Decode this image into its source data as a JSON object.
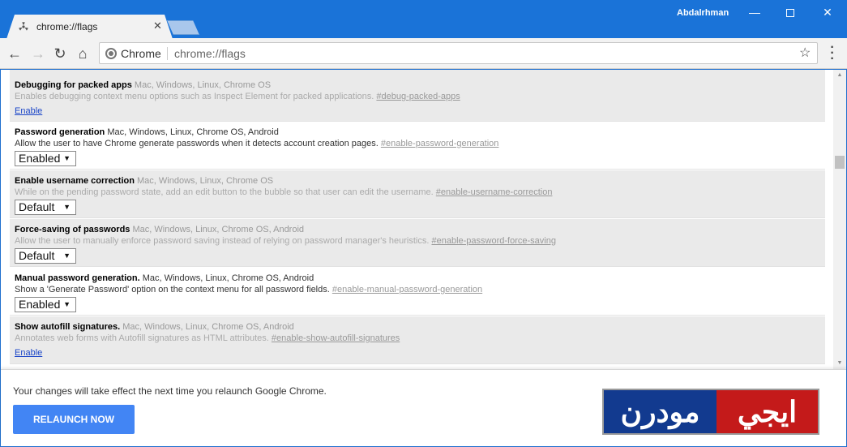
{
  "window": {
    "user_name": "Abdalrhman",
    "minimize": "—",
    "close": "✕"
  },
  "tab": {
    "title": "chrome://flags",
    "close": "✕"
  },
  "toolbar": {
    "back": "←",
    "forward": "→",
    "reload": "↻",
    "home": "⌂",
    "omnibox_label": "Chrome",
    "url": "chrome://flags",
    "star": "☆",
    "menu": "⋮"
  },
  "flags": [
    {
      "name": "Debugging for packed apps",
      "platforms": " Mac, Windows, Linux, Chrome OS",
      "description": "Enables debugging context menu options such as Inspect Element for packed applications. ",
      "hash": "#debug-packed-apps",
      "control": "link",
      "value": "Enable",
      "unsupported": true
    },
    {
      "name": "Password generation",
      "platforms": " Mac, Windows, Linux, Chrome OS, Android",
      "description": "Allow the user to have Chrome generate passwords when it detects account creation pages. ",
      "hash": "#enable-password-generation",
      "control": "select",
      "value": "Enabled",
      "unsupported": false
    },
    {
      "name": "Enable username correction",
      "platforms": " Mac, Windows, Linux, Chrome OS",
      "description": "While on the pending password state, add an edit button to the bubble so that user can edit the username. ",
      "hash": "#enable-username-correction",
      "control": "select",
      "value": "Default",
      "unsupported": true
    },
    {
      "name": "Force-saving of passwords",
      "platforms": " Mac, Windows, Linux, Chrome OS, Android",
      "description": "Allow the user to manually enforce password saving instead of relying on password manager's heuristics. ",
      "hash": "#enable-password-force-saving",
      "control": "select",
      "value": "Default",
      "unsupported": true
    },
    {
      "name": "Manual password generation.",
      "platforms": " Mac, Windows, Linux, Chrome OS, Android",
      "description": "Show a 'Generate Password' option on the context menu for all password fields. ",
      "hash": "#enable-manual-password-generation",
      "control": "select",
      "value": "Enabled",
      "unsupported": false
    },
    {
      "name": "Show autofill signatures.",
      "platforms": " Mac, Windows, Linux, Chrome OS, Android",
      "description": "Annotates web forms with Autofill signatures as HTML attributes. ",
      "hash": "#enable-show-autofill-signatures",
      "control": "link",
      "value": "Enable",
      "unsupported": true
    }
  ],
  "relaunch": {
    "message": "Your changes will take effect the next time you relaunch Google Chrome.",
    "button": "RELAUNCH NOW"
  },
  "logo": {
    "left_text": "مودرن",
    "right_text": "ايجي"
  },
  "colors": {
    "accent": "#4285f4",
    "titlebar": "#1a73d8",
    "logo_blue": "#123a8f",
    "logo_red": "#c41a1a"
  }
}
